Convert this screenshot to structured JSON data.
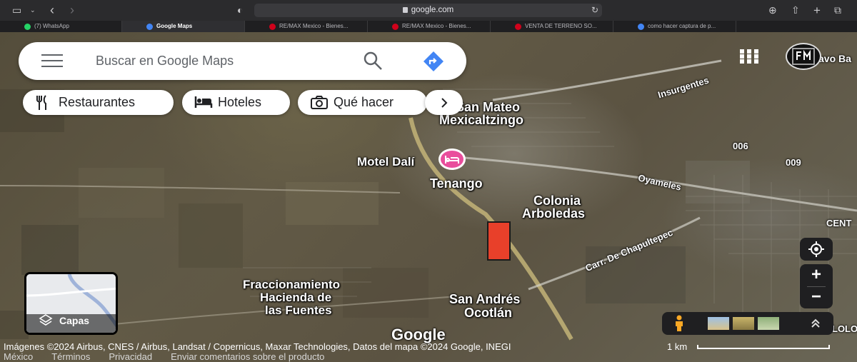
{
  "browser": {
    "url": "google.com",
    "tabs": [
      {
        "label": "(7) WhatsApp",
        "active": false,
        "color": "#25d366"
      },
      {
        "label": "Google Maps",
        "active": true,
        "color": "#4285f4"
      },
      {
        "label": "RE/MAX Mexico - Bienes...",
        "active": false,
        "color": "#d0021b"
      },
      {
        "label": "RE/MAX Mexico - Bienes...",
        "active": false,
        "color": "#d0021b"
      },
      {
        "label": "VENTA DE TERRENO SO...",
        "active": false,
        "color": "#d0021b"
      },
      {
        "label": "como hacer captura de p...",
        "active": false,
        "color": "#4285f4"
      }
    ]
  },
  "search": {
    "placeholder": "Buscar en Google Maps"
  },
  "chips": [
    {
      "label": "Restaurantes",
      "icon": "fork-knife-icon"
    },
    {
      "label": "Hoteles",
      "icon": "bed-icon"
    },
    {
      "label": "Qué hacer",
      "icon": "camera-icon"
    }
  ],
  "map_labels": {
    "san_mateo": "San Mateo",
    "mexicaltzingo": "Mexicaltzingo",
    "motel": "Motel Dalí",
    "tenango": "Tenango",
    "colonia": "Colonia",
    "arboledas": "Arboledas",
    "fracc1": "Fraccionamiento",
    "fracc2": "Hacienda de",
    "fracc3": "las Fuentes",
    "san_andres": "San Andrés",
    "ocotlan": "Ocotlán",
    "insurgentes": "Insurgentes",
    "oyameles": "Oyameles",
    "chapultepec": "Carr. De Chapultepec",
    "n006": "006",
    "n009": "009",
    "cent": "CENT",
    "lolo": "LOLO",
    "avo_ba": "avo Ba"
  },
  "layers": {
    "label": "Capas"
  },
  "controls": {
    "zoom_in": "+",
    "zoom_out": "−"
  },
  "watermark": "Google",
  "attribution": {
    "line1": "Imágenes ©2024 Airbus, CNES / Airbus, Landsat / Copernicus, Maxar Technologies, Datos del mapa ©2024 Google, INEGI",
    "country": "México",
    "terms": "Términos",
    "privacy": "Privacidad",
    "feedback": "Enviar comentarios sobre el producto",
    "scale": "1 km"
  },
  "colors": {
    "marker": "#e8402a",
    "hotel_pin": "#e94e9c",
    "directions": "#4285f4"
  }
}
